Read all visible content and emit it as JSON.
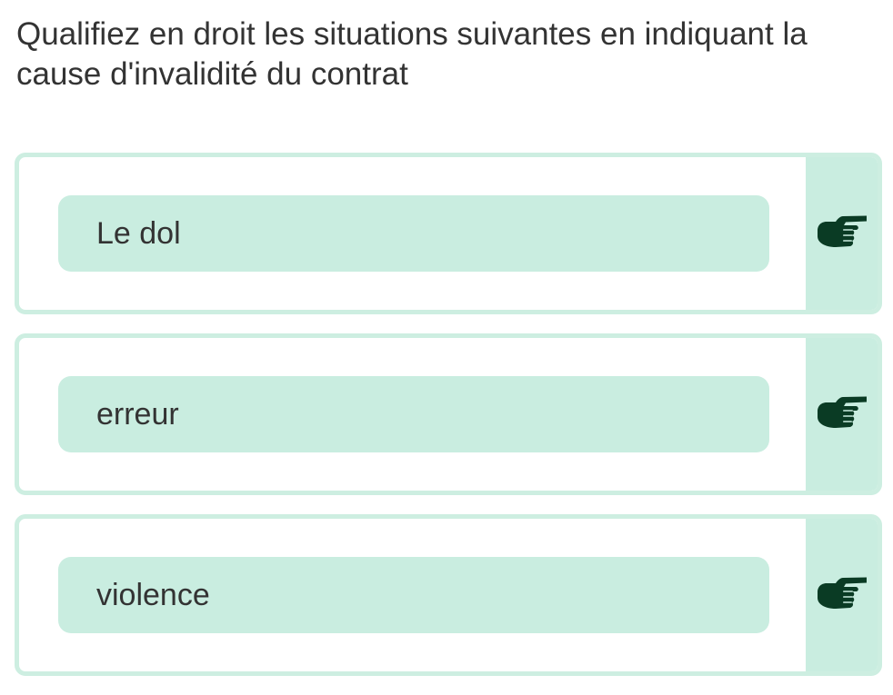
{
  "question": "Qualifiez en droit les situations suivantes en indiquant  la cause d'invalidité du contrat",
  "items": [
    {
      "label": "Le dol",
      "icon": "pointing-hand-icon"
    },
    {
      "label": "erreur",
      "icon": "pointing-hand-icon"
    },
    {
      "label": "violence",
      "icon": "pointing-hand-icon"
    }
  ],
  "colors": {
    "card_border": "#cdeee1",
    "answer_fill": "#c9ede0",
    "icon": "#0a3b24",
    "text": "#333333"
  }
}
